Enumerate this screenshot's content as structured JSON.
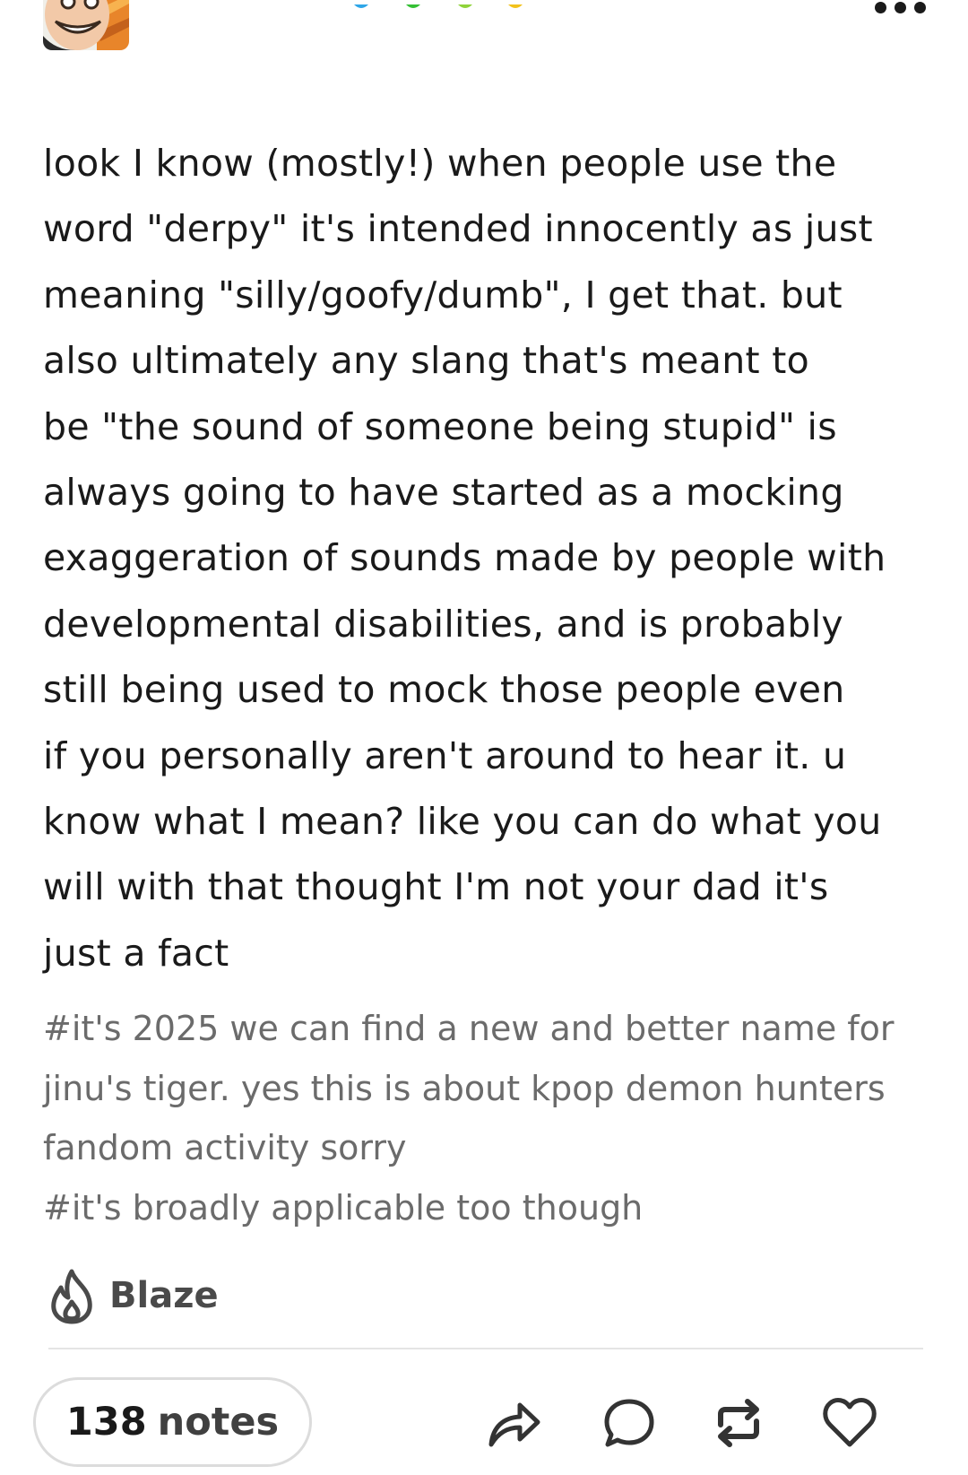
{
  "post": {
    "avatar_icon": "avatar-cartoon-face",
    "more_icon": "more-options-icon",
    "body_text": "look I know (mostly!) when people use the\nword \"derpy\" it's intended innocently as just\nmeaning \"silly/goofy/dumb\", I get that. but\nalso ultimately any slang that's meant to\nbe \"the sound of someone being stupid\" is\nalways going to have started as a mocking\nexaggeration of sounds made by people with\ndevelopmental disabilities, and is probably\nstill being used to mock those people even\nif you personally aren't around to hear it.  u\nknow what I mean?  like you can do what you\nwill with that thought I'm not your dad it's\njust a fact",
    "tags": [
      "#it's 2025 we can find a new and better name for jinu's tiger. yes this is about kpop demon hunters fandom activity sorry",
      "#it's broadly applicable too though"
    ]
  },
  "actions": {
    "blaze_label": "Blaze",
    "blaze_icon": "flame-icon",
    "notes_count": "138",
    "notes_label": "notes",
    "share_icon": "share-arrow-icon",
    "reply_icon": "comment-bubble-icon",
    "reblog_icon": "reblog-icon",
    "like_icon": "heart-icon"
  },
  "colors": {
    "text": "#1a1a1a",
    "tags": "#6b6b6b",
    "divider": "#e4e4e4",
    "accent_blue": "#2ea6e8",
    "accent_green": "#35c035",
    "accent_lime": "#8fd33a",
    "accent_yellow": "#f2c21b"
  }
}
